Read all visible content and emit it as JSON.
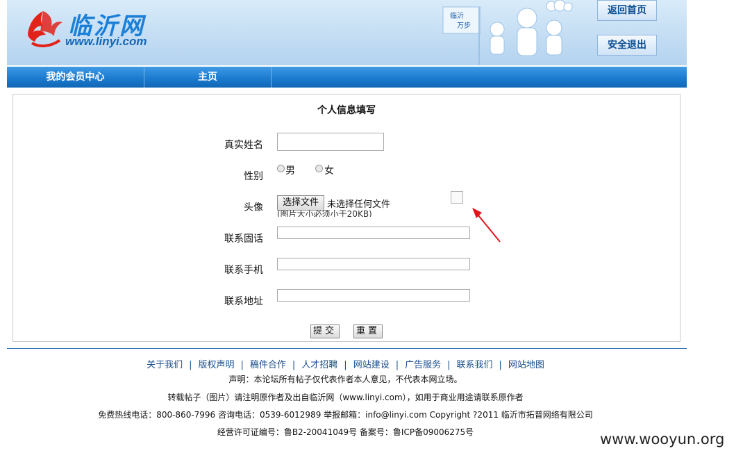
{
  "header": {
    "logo_cn": "临沂网",
    "logo_url": "www.linyi.com",
    "flag_text": "临沂 万步",
    "back_home": "返回首页",
    "logout": "安全退出"
  },
  "nav": {
    "items": [
      "我的会员中心",
      "主页"
    ]
  },
  "form": {
    "title": "个人信息填写",
    "name_label": "真实姓名",
    "gender_label": "性别",
    "gender_male": "男",
    "gender_female": "女",
    "avatar_label": "头像",
    "file_button": "选择文件",
    "file_status": "未选择任何文件",
    "file_note": "(图片大小必须小于20KB)",
    "phone_label": "联系固话",
    "mobile_label": "联系手机",
    "address_label": "联系地址",
    "submit": "提交",
    "reset": "重置"
  },
  "footer": {
    "links": [
      "关于我们",
      "版权声明",
      "稿件合作",
      "人才招聘",
      "网站建设",
      "广告服务",
      "联系我们",
      "网站地图"
    ],
    "statement": "声明：本论坛所有帖子仅代表作者本人意见，不代表本网立场。",
    "repost": "转载帖子（图片）请注明原作者及出自临沂网（www.linyi.com），如用于商业用途请联系原作者",
    "contact": "免费热线电话：800-860-7996 咨询电话：0539-6012989 举报邮箱：info@linyi.com Copyright ?2011 临沂市拓普网络有限公司",
    "license": "经营许可证编号：鲁B2-20041049号 备案号：鲁ICP备09006275号"
  },
  "watermark": "www.wooyun.org"
}
